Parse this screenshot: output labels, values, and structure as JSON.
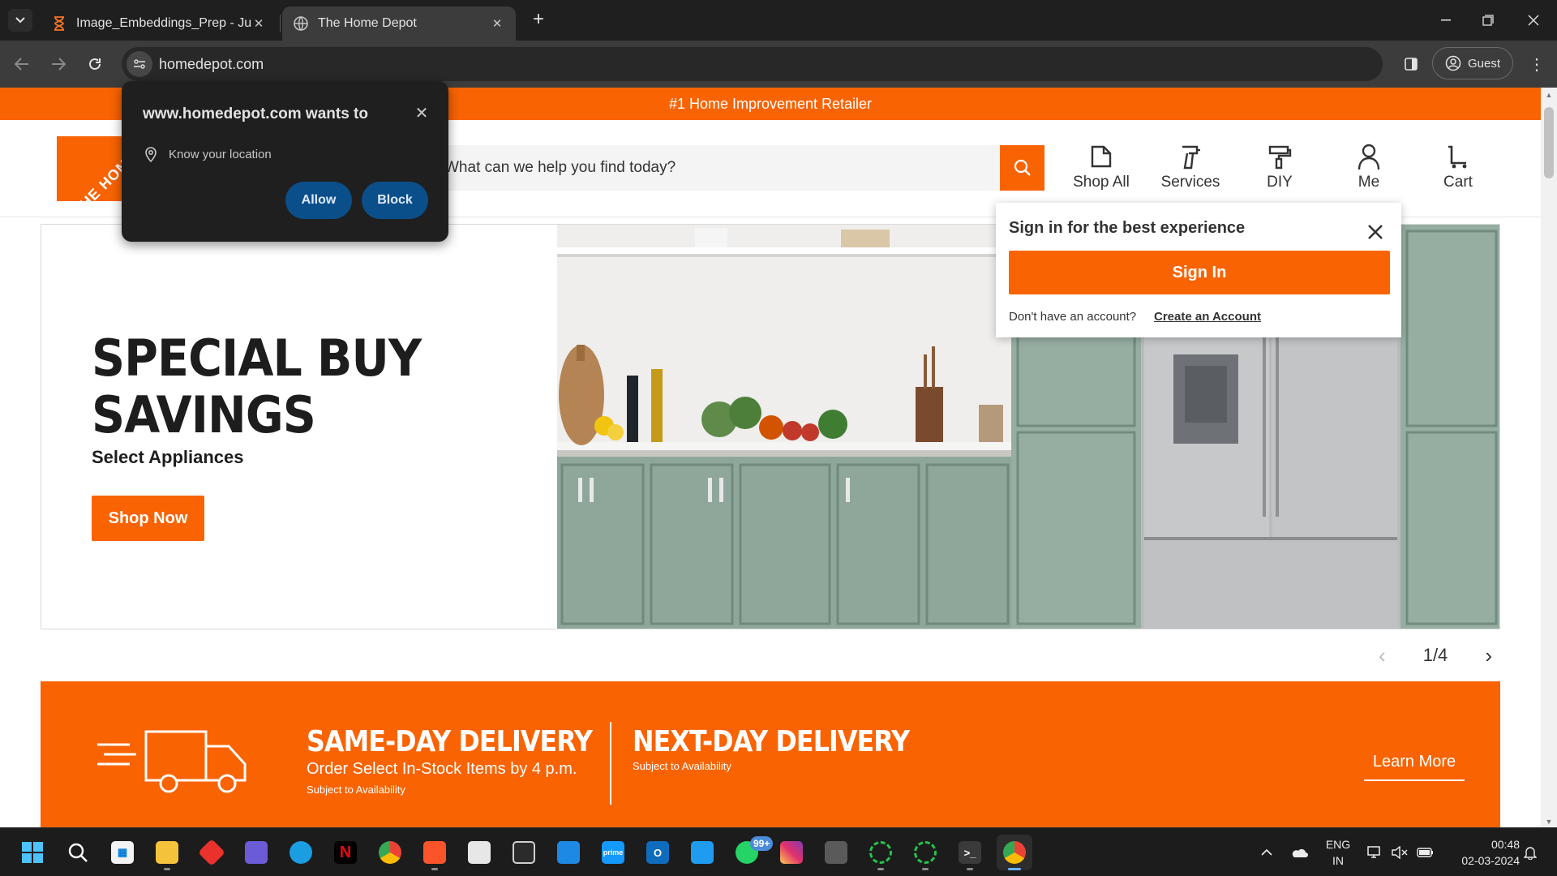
{
  "browser": {
    "tabs": [
      {
        "title": "Image_Embeddings_Prep - Jupyter",
        "active": false,
        "favicon": "hourglass-icon"
      },
      {
        "title": "The Home Depot",
        "active": true,
        "favicon": "globe-icon"
      }
    ],
    "url": "homedepot.com",
    "profile_label": "Guest"
  },
  "permission_prompt": {
    "title": "www.homedepot.com wants to",
    "request": "Know your location",
    "allow_label": "Allow",
    "block_label": "Block"
  },
  "site": {
    "promo_text": "#1 Home Improvement Retailer",
    "logo_text": "THE HOME DEPOT",
    "search_placeholder": "What can we help you find today?",
    "nav": [
      {
        "label": "Shop All",
        "icon": "shop-all-icon"
      },
      {
        "label": "Services",
        "icon": "services-drill-icon"
      },
      {
        "label": "DIY",
        "icon": "diy-paint-roller-icon"
      },
      {
        "label": "Me",
        "icon": "user-icon"
      },
      {
        "label": "Cart",
        "icon": "cart-icon"
      }
    ],
    "signin_flyout": {
      "title": "Sign in for the best experience",
      "button_label": "Sign In",
      "no_account_text": "Don't have an account?",
      "create_link": "Create an Account"
    },
    "hero": {
      "title_line1": "SPECIAL BUY",
      "title_line2": "SAVINGS",
      "subtitle": "Select Appliances",
      "cta_label": "Shop Now"
    },
    "carousel": {
      "indicator": "1/4"
    },
    "delivery": {
      "same_day_title": "SAME-DAY DELIVERY",
      "same_day_line": "Order Select In-Stock Items by 4 p.m.",
      "same_day_note": "Subject to Availability",
      "next_day_title": "NEXT-DAY DELIVERY",
      "next_day_note": "Subject to Availability",
      "learn_more": "Learn More"
    }
  },
  "taskbar": {
    "language_line1": "ENG",
    "language_line2": "IN",
    "time": "00:48",
    "date": "02-03-2024",
    "whatsapp_badge": "99+"
  },
  "colors": {
    "brand_orange": "#f96302",
    "chrome_dark": "#1f1f1f",
    "permission_button": "#0b4f8a"
  }
}
